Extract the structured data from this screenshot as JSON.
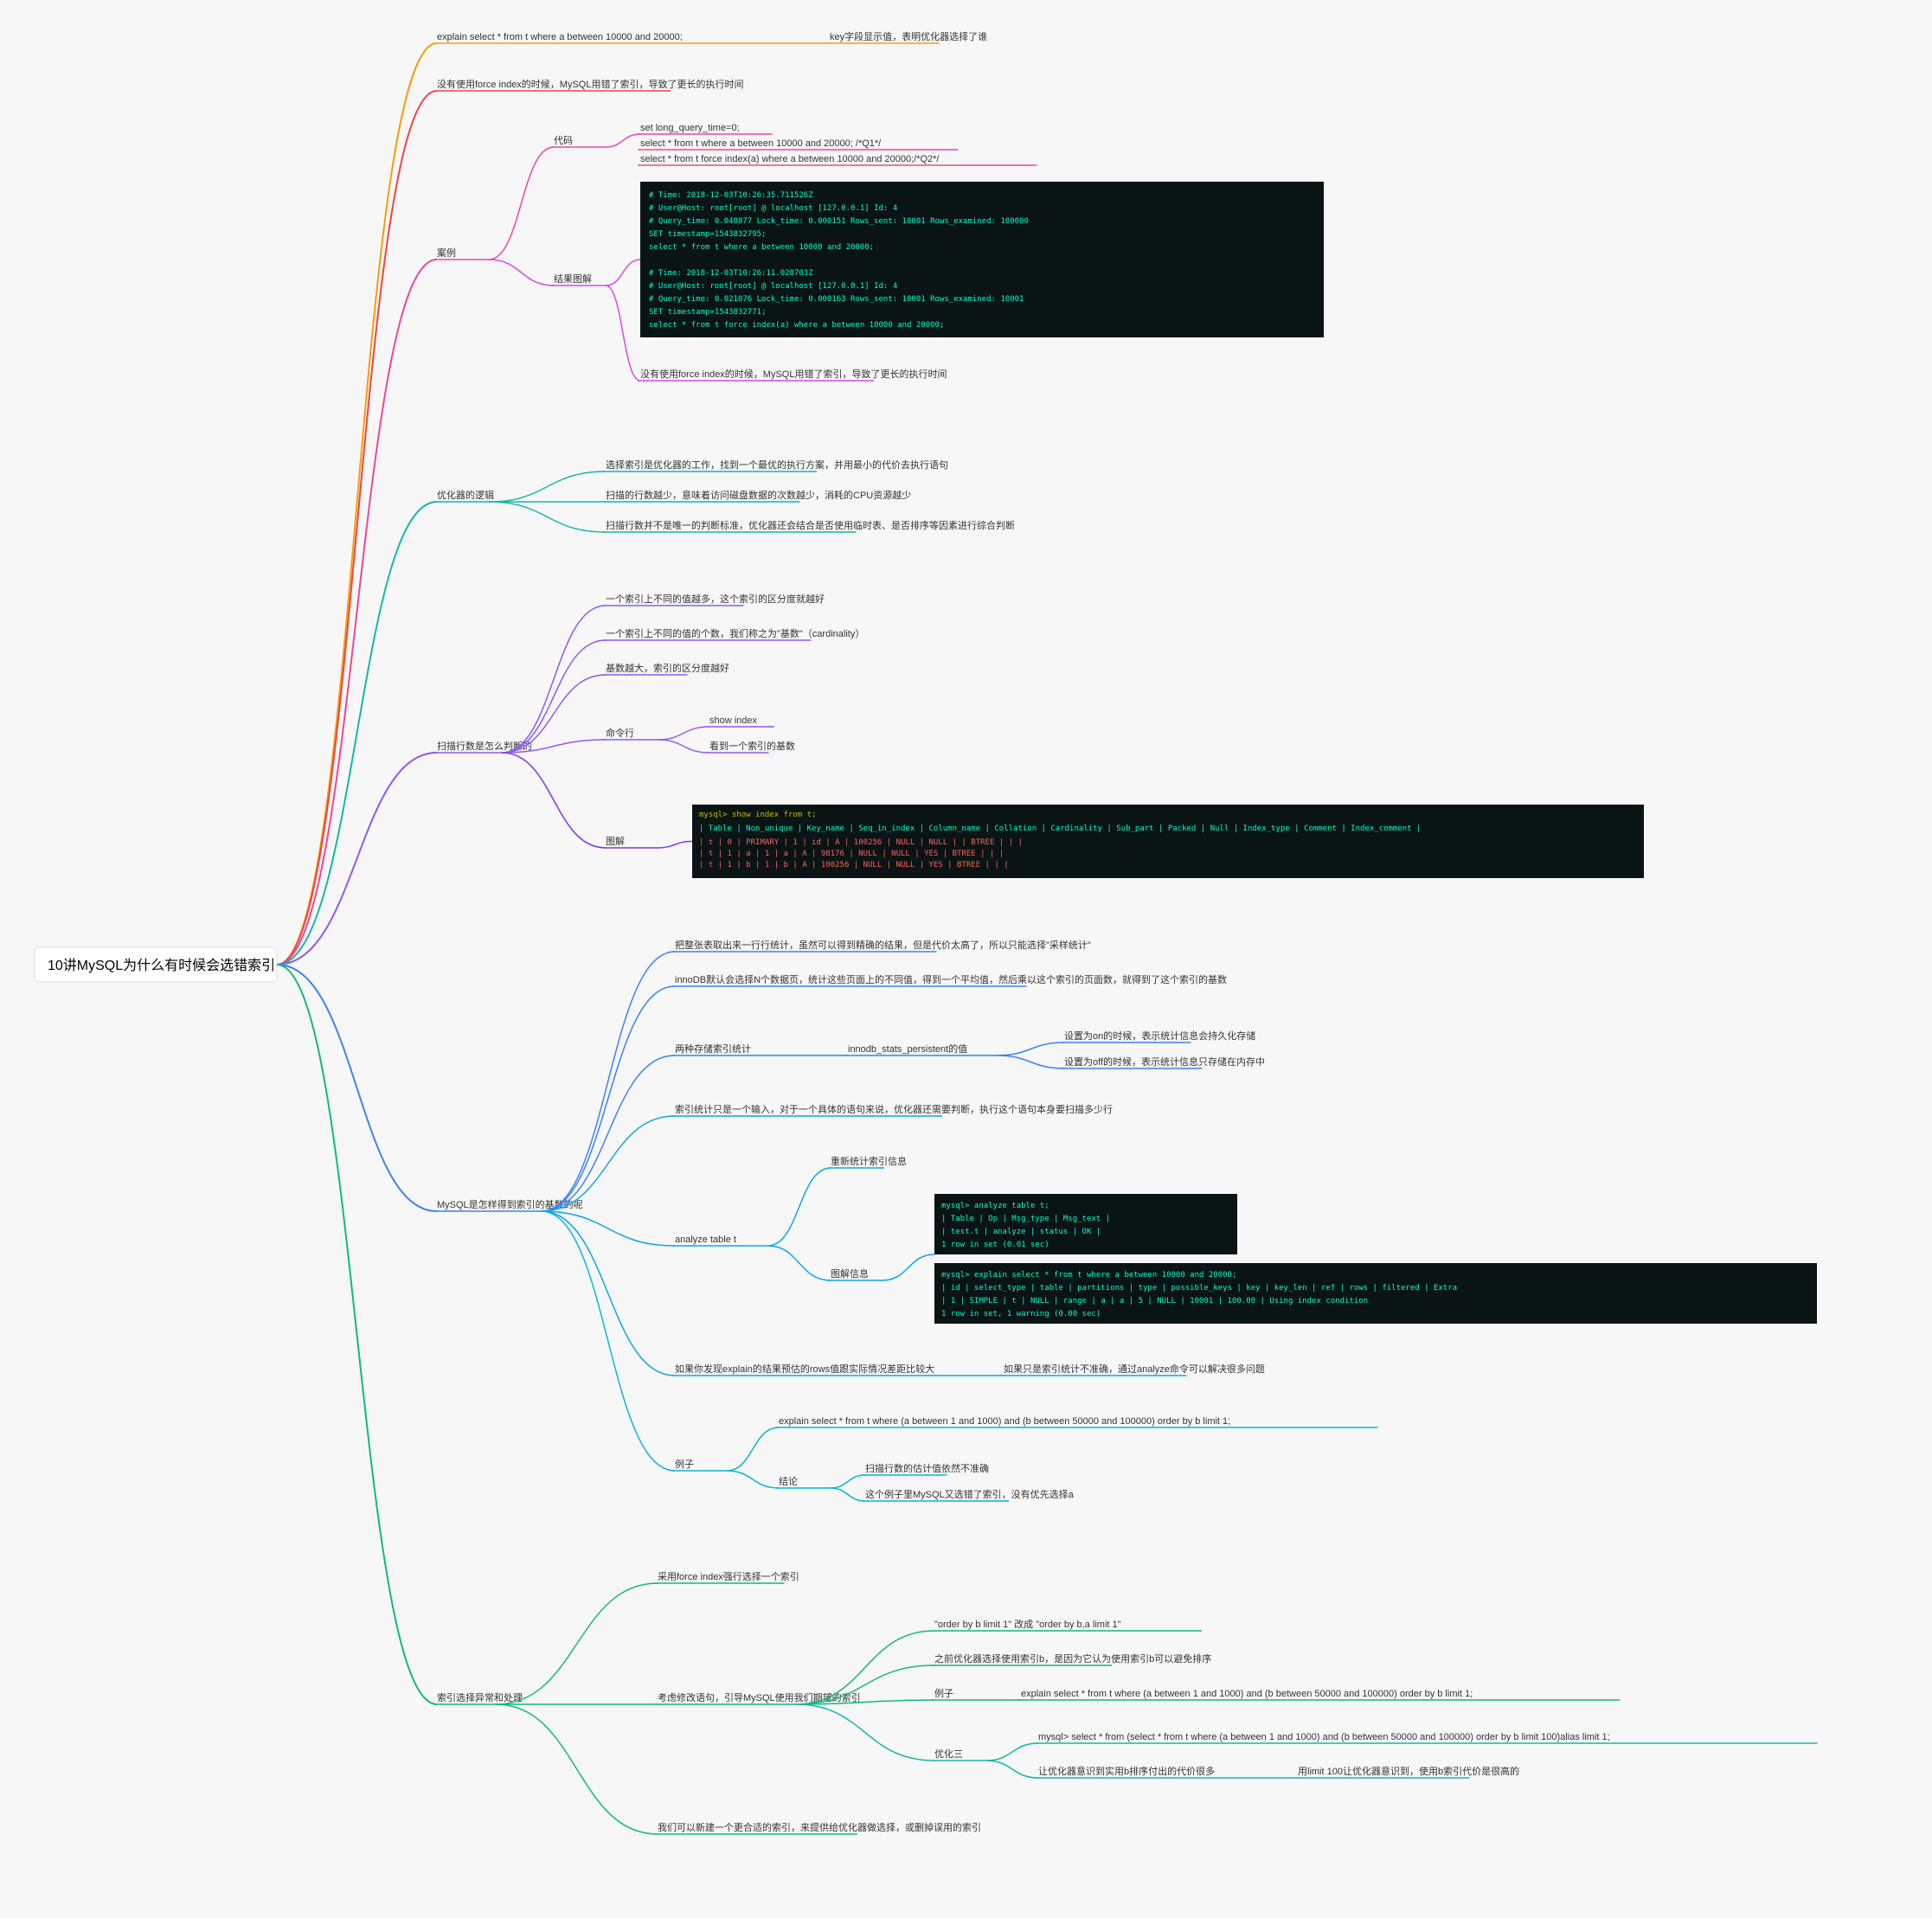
{
  "root": "10讲MySQL为什么有时候会选错索引",
  "n1": {
    "label": "explain select * from t where a between 10000 and 20000;",
    "note": "key字段显示值，表明优化器选择了谁"
  },
  "n2": {
    "label": "没有使用force index的时候，MySQL用错了索引，导致了更长的执行时间"
  },
  "n3": {
    "label": "案例",
    "code": {
      "label": "代码",
      "lines": [
        "set long_query_time=0;",
        "select * from t where a between 10000 and 20000; /*Q1*/",
        "select * from t force index(a) where a between 10000 and 20000;/*Q2*/"
      ]
    },
    "result": {
      "label": "结果图解",
      "terminal": [
        "# Time: 2018-12-03T10:26:35.711526Z",
        "# User@Host: root[root] @ localhost [127.0.0.1]  Id:     4",
        "# Query_time: 0.040877  Lock_time: 0.000151 Rows_sent: 10001  Rows_examined: 100000",
        "SET timestamp=1543832795;",
        "select * from t where a between 10000 and 20000;",
        "",
        "# Time: 2018-12-03T10:26:11.028703Z",
        "# User@Host: root[root] @ localhost [127.0.0.1]  Id:     4",
        "# Query_time: 0.021076  Lock_time: 0.000163 Rows_sent: 10001  Rows_examined: 10001",
        "SET timestamp=1543832771;",
        "select * from t force index(a) where a between 10000 and 20000;"
      ],
      "caption": "没有使用force index的时候，MySQL用错了索引，导致了更长的执行时间"
    }
  },
  "n4": {
    "label": "优化器的逻辑",
    "items": [
      "选择索引是优化器的工作，找到一个最优的执行方案，并用最小的代价去执行语句",
      "扫描的行数越少，意味着访问磁盘数据的次数越少，消耗的CPU资源越少",
      "扫描行数并不是唯一的判断标准，优化器还会结合是否使用临时表、是否排序等因素进行综合判断"
    ]
  },
  "n5": {
    "label": "扫描行数是怎么判断的",
    "items": [
      "一个索引上不同的值越多，这个索引的区分度就越好",
      "一个索引上不同的值的个数，我们称之为\"基数\"（cardinality）",
      "基数越大，索引的区分度越好"
    ],
    "cmd": {
      "label": "命令行",
      "sub": [
        "show index",
        "看到一个索引的基数"
      ]
    },
    "diagram": {
      "label": "图解",
      "header": "mysql> show index from t;",
      "cols": [
        "Table",
        "Non_unique",
        "Key_name",
        "Seq_in_index",
        "Column_name",
        "Collation",
        "Cardinality",
        "Sub_part",
        "Packed",
        "Null",
        "Index_type",
        "Comment",
        "Index_comment"
      ],
      "rows": [
        [
          "t",
          "0",
          "PRIMARY",
          "1",
          "id",
          "A",
          "100256",
          "NULL",
          "NULL",
          "",
          "BTREE",
          "",
          ""
        ],
        [
          "t",
          "1",
          "a",
          "1",
          "a",
          "A",
          "98176",
          "NULL",
          "NULL",
          "YES",
          "BTREE",
          "",
          ""
        ],
        [
          "t",
          "1",
          "b",
          "1",
          "b",
          "A",
          "100256",
          "NULL",
          "NULL",
          "YES",
          "BTREE",
          "",
          ""
        ]
      ]
    }
  },
  "n6": {
    "label": "MySQL是怎样得到索引的基数的呢",
    "items": [
      "把整张表取出来一行行统计，虽然可以得到精确的结果，但是代价太高了，所以只能选择\"采样统计\"",
      "innoDB默认会选择N个数据页，统计这些页面上的不同值，得到一个平均值，然后乘以这个索引的页面数，就得到了这个索引的基数"
    ],
    "storage": {
      "label": "两种存储索引统计",
      "key": "innodb_stats_persistent的值",
      "opts": [
        "设置为on的时候，表示统计信息会持久化存储",
        "设置为off的时候，表示统计信息只存储在内存中"
      ]
    },
    "note": "索引统计只是一个输入，对于一个具体的语句来说，优化器还需要判断，执行这个语句本身要扫描多少行",
    "analyze": {
      "label": "analyze table t",
      "sub1": "重新统计索引信息",
      "sub2": "图解信息",
      "t1": [
        "mysql> analyze table t;",
        "| Table   | Op      | Msg_type | Msg_text |",
        "| test.t  | analyze | status   | OK       |",
        "1 row in set (0.01 sec)"
      ],
      "t2": [
        "mysql>  explain select * from t where a between 10000 and 20000;",
        "| id | select_type | table | partitions | type  | possible_keys | key | key_len | ref  | rows  | filtered | Extra",
        "| 1  | SIMPLE      | t     | NULL       | range | a             | a   | 5       | NULL | 10001 | 100.00   | Using index condition",
        "1 row in set, 1 warning (0.00 sec)"
      ]
    },
    "explain": {
      "a": "如果你发现explain的结果预估的rows值跟实际情况差距比较大",
      "b": "如果只是索引统计不准确，通过analyze命令可以解决很多问题"
    },
    "example": {
      "label": "例子",
      "q": "explain select * from t where (a between 1 and 1000) and (b between 50000 and 100000) order by b limit 1;",
      "concl": {
        "label": "结论",
        "items": [
          "扫描行数的估计值依然不准确",
          "这个例子里MySQL又选错了索引，没有优先选择a"
        ]
      }
    }
  },
  "n7": {
    "label": "索引选择异常和处理",
    "i1": "采用force index强行选择一个索引",
    "i2": {
      "label": "考虑修改语句，引导MySQL使用我们期望的索引",
      "s1": "\"order by b limit 1\" 改成 \"order by b,a limit 1\"",
      "s2": "之前优化器选择使用索引b，是因为它认为使用索引b可以避免排序",
      "ex": {
        "label": "例子",
        "q": "explain select * from t where (a between 1 and 1000) and (b between 50000 and 100000) order by b limit 1;"
      },
      "opt3": {
        "label": "优化三",
        "q": "mysql> select * from  (select * from t where (a between 1 and 1000)  and (b between 50000 and 100000) order by b limit 100)alias limit 1;",
        "c1": "让优化器意识到实用b排序付出的代价很多",
        "c2": "用limit 100让优化器意识到，使用b索引代价是很高的"
      }
    },
    "i3": "我们可以新建一个更合适的索引，来提供给优化器做选择，或删掉误用的索引"
  },
  "colors": {
    "orange": "#f59e0b",
    "red": "#ef4444",
    "pink": "#ec4899",
    "magenta": "#d946ef",
    "teal": "#14b8a6",
    "purple": "#8b5cf6",
    "violet": "#7c3aed",
    "blue": "#3b82f6",
    "sky": "#0ea5e9",
    "green": "#10b981",
    "cyan": "#06b6d4"
  }
}
